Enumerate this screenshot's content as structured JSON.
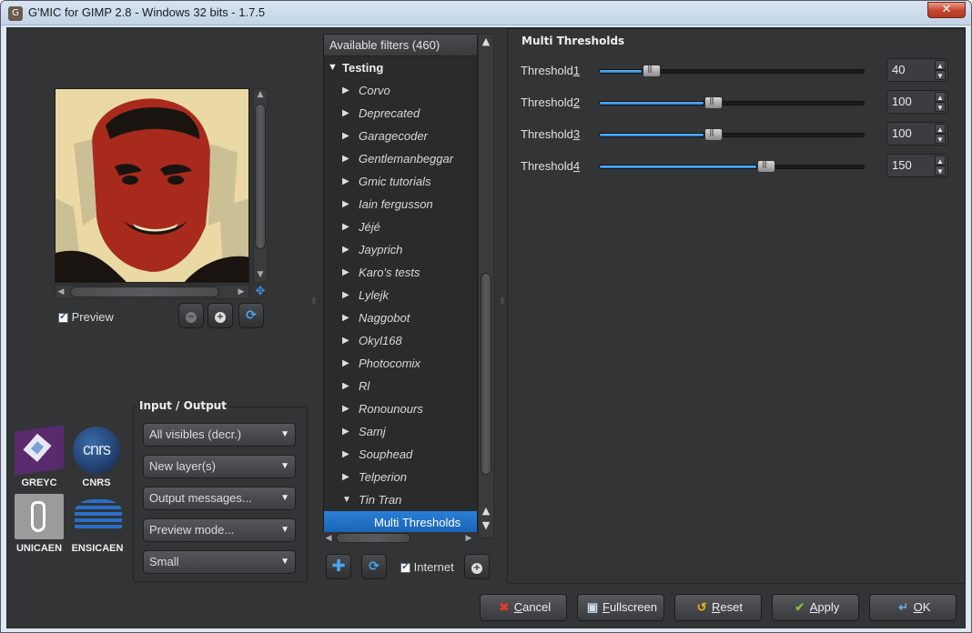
{
  "window": {
    "title": "G'MIC for GIMP 2.8 - Windows 32 bits - 1.7.5",
    "close_label": "✕"
  },
  "preview": {
    "checkbox_label": "Preview",
    "checked": true
  },
  "io": {
    "title": "Input / Output",
    "combos": [
      "All visibles (decr.)",
      "New layer(s)",
      "Output messages...",
      "Preview mode...",
      "Small"
    ]
  },
  "logos": [
    "GREYC",
    "CNRS",
    "UNICAEN",
    "ENSICAEN"
  ],
  "filters": {
    "header": "Available filters (460)",
    "category": "Testing",
    "items": [
      "Corvo",
      "Deprecated",
      "Garagecoder",
      "Gentlemanbeggar",
      "Gmic tutorials",
      "Iain fergusson",
      "Jéjé",
      "Jayprich",
      "Karo's tests",
      "Lylejk",
      "Naggobot",
      "Okyl168",
      "Photocomix",
      "Rl",
      "Ronounours",
      "Samj",
      "Souphead",
      "Telperion",
      "Tin Tran"
    ],
    "expanded": "Tin Tran",
    "selected": "Multi Thresholds",
    "internet_label": "Internet",
    "internet_checked": true
  },
  "params": {
    "title": "Multi Thresholds",
    "sliders": [
      {
        "label": "Threshold",
        "mnemonic": "1",
        "value": "40",
        "fraction": 0.157
      },
      {
        "label": "Threshold",
        "mnemonic": "2",
        "value": "100",
        "fraction": 0.392
      },
      {
        "label": "Threshold",
        "mnemonic": "3",
        "value": "100",
        "fraction": 0.392
      },
      {
        "label": "Threshold",
        "mnemonic": "4",
        "value": "150",
        "fraction": 0.588
      }
    ]
  },
  "buttons": {
    "cancel": {
      "mnemonic": "C",
      "rest": "ancel"
    },
    "fullscreen": {
      "mnemonic": "F",
      "rest": "ullscreen"
    },
    "reset": {
      "mnemonic": "R",
      "rest": "eset"
    },
    "apply": {
      "mnemonic": "A",
      "rest": "pply"
    },
    "ok": {
      "mnemonic": "O",
      "rest": "K"
    }
  },
  "colors": {
    "accent": "#2a80d8",
    "panel": "#333436",
    "selection": "#1a62b3"
  }
}
